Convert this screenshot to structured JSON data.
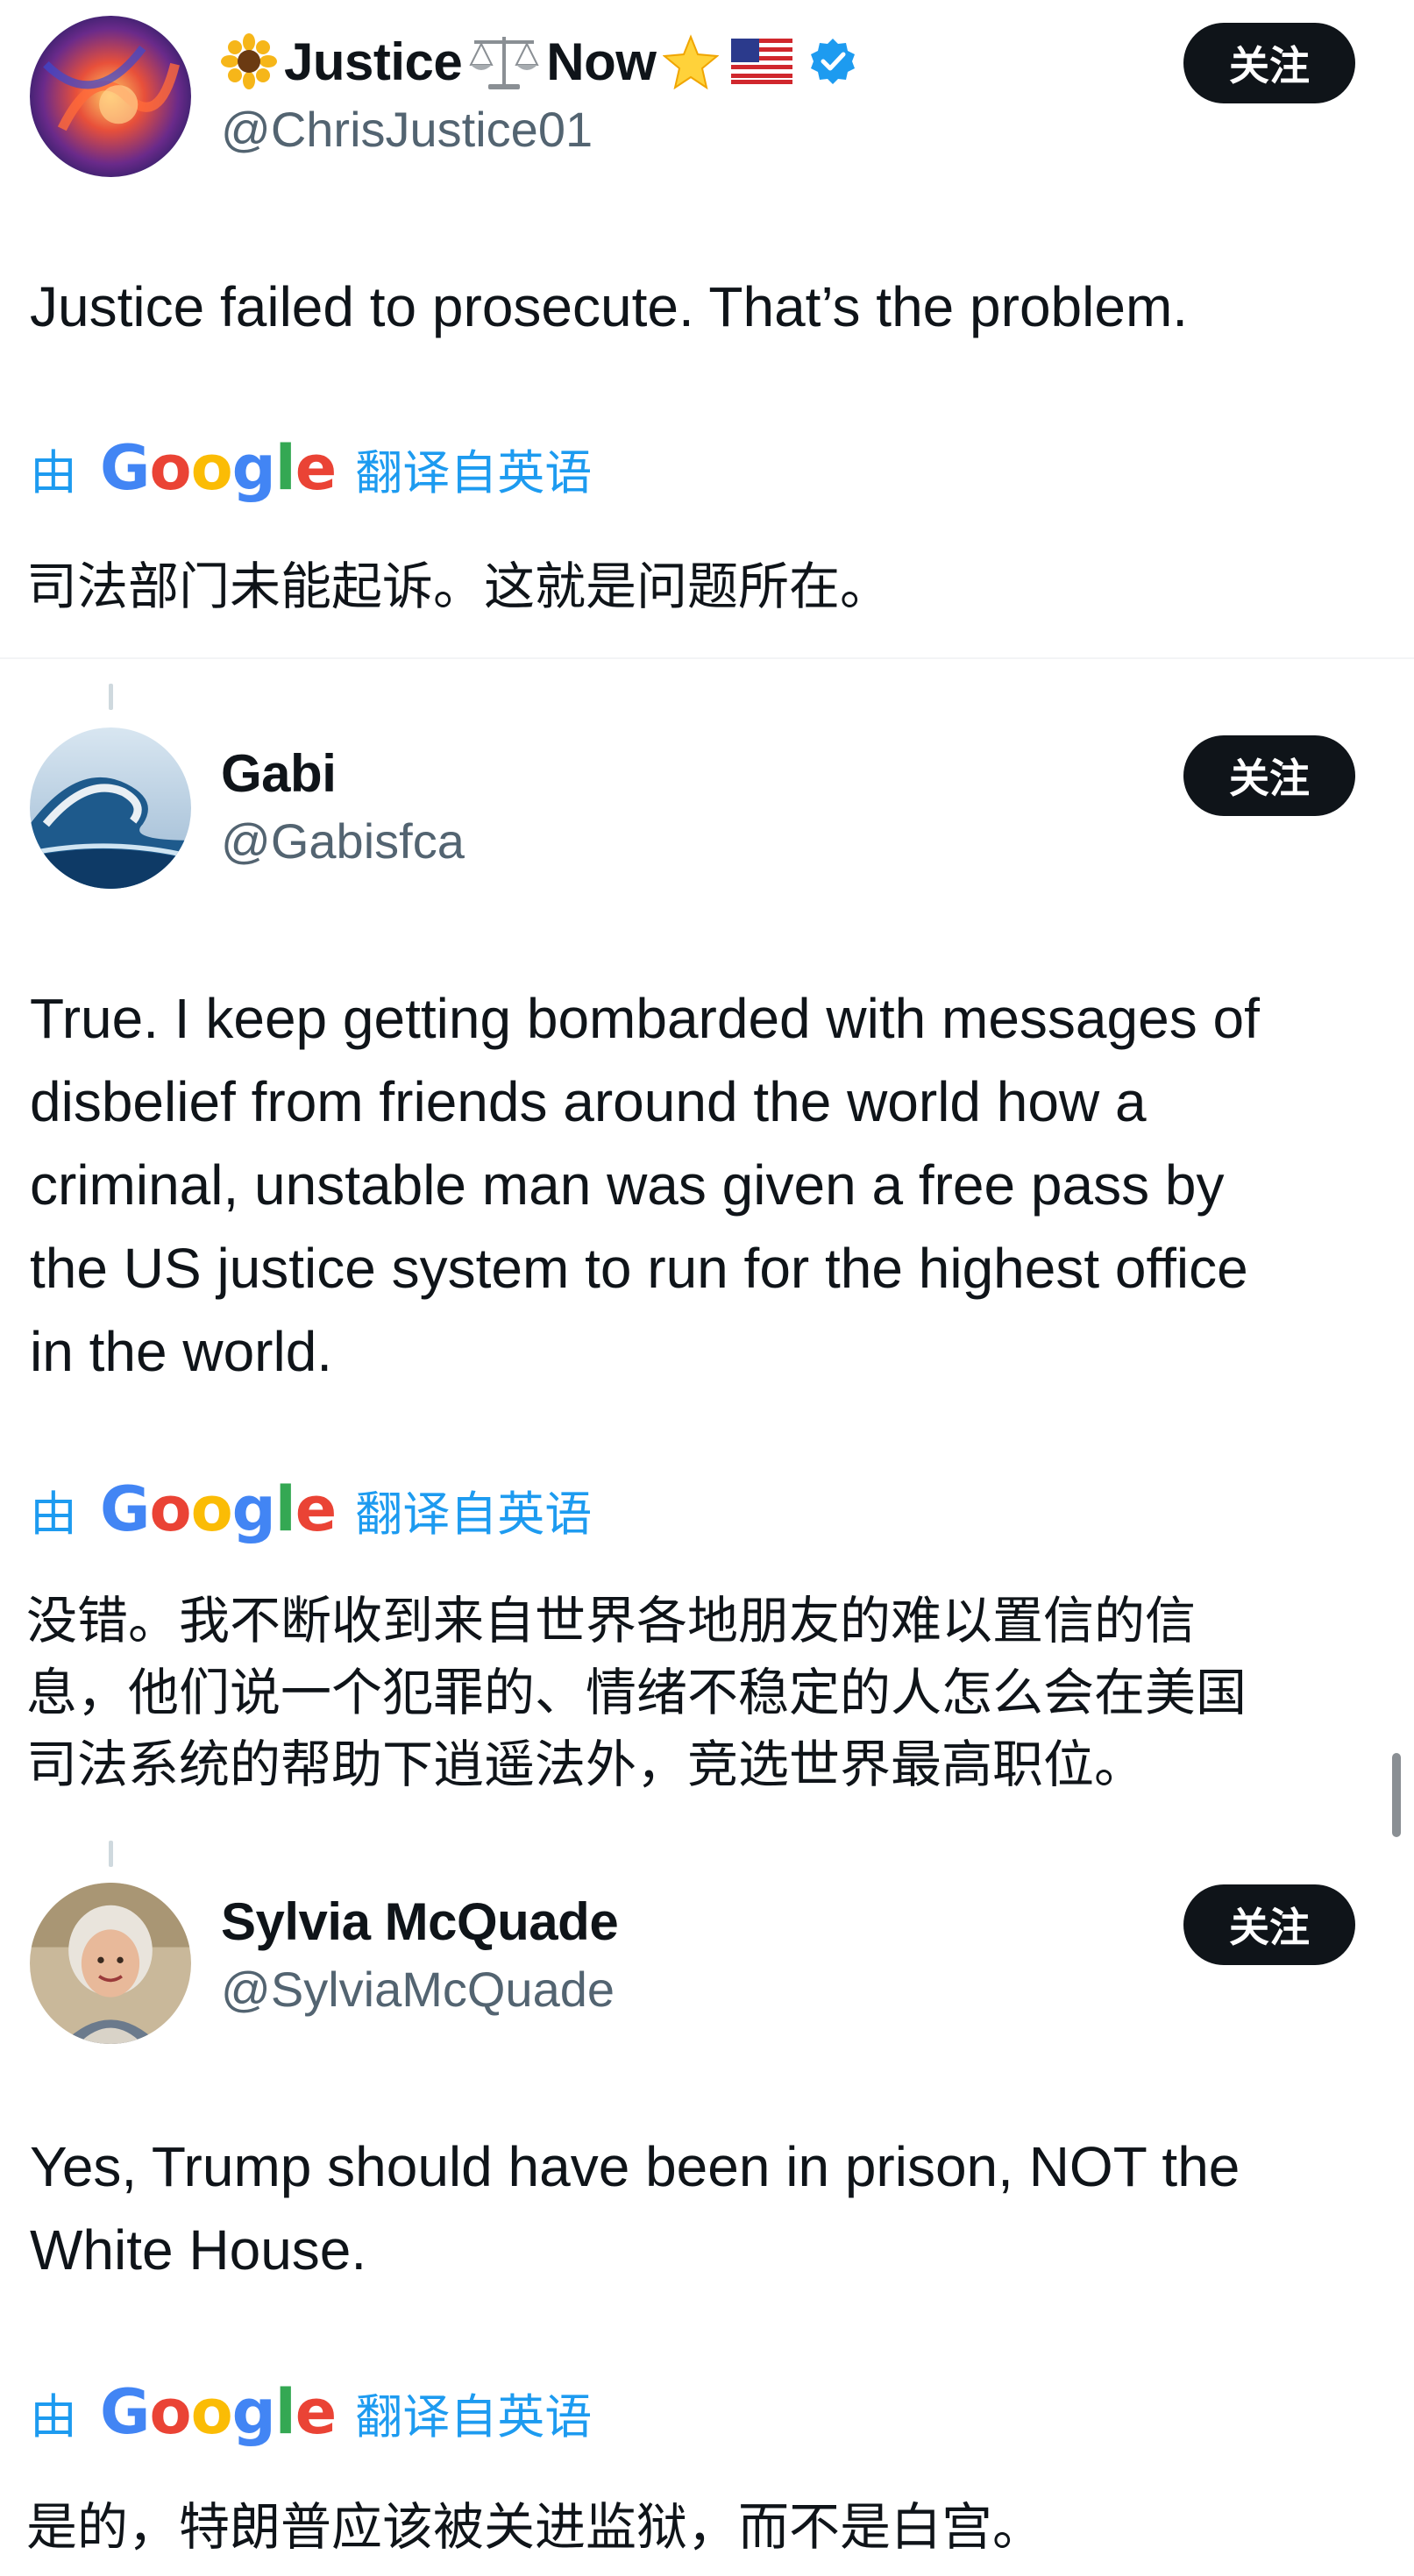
{
  "posts": [
    {
      "display_name": "Justice",
      "display_name_2": "Now",
      "handle": "@ChrisJustice01",
      "follow_label": "关注",
      "text": "Justice failed to prosecute. That’s the problem.",
      "translate_by": "由",
      "translate_google": "Google",
      "translate_suffix": "翻译自英语",
      "translated": "司法部门未能起诉。这就是问题所在。",
      "verified": true
    },
    {
      "display_name": "Gabi",
      "handle": "@Gabisfca",
      "follow_label": "关注",
      "text": "True. I keep getting bombarded with messages of\ndisbelief from friends around the world how a\ncriminal, unstable man was given a free pass by\nthe US justice system to run for the highest office\nin the world.",
      "translate_by": "由",
      "translate_google": "Google",
      "translate_suffix": "翻译自英语",
      "translated": "没错。我不断收到来自世界各地朋友的难以置信的信\n息，他们说一个犯罪的、情绪不稳定的人怎么会在美国\n司法系统的帮助下逍遥法外，竞选世界最高职位。"
    },
    {
      "display_name": "Sylvia McQuade",
      "handle": "@SylviaMcQuade",
      "follow_label": "关注",
      "text": "Yes, Trump should have been in prison, NOT the\nWhite House.",
      "translate_by": "由",
      "translate_google": "Google",
      "translate_suffix": "翻译自英语",
      "translated": "是的，特朗普应该被关进监狱，而不是白宫。"
    }
  ],
  "icons": {
    "sunflower": "sunflower-icon",
    "scales": "scales-icon",
    "star": "star-icon",
    "flag": "us-flag-icon",
    "verified": "verified-badge-icon"
  },
  "colors": {
    "link_blue": "#1d9bf0",
    "follow_bg": "#0f1419",
    "text": "#0f1419",
    "muted": "#536471"
  }
}
